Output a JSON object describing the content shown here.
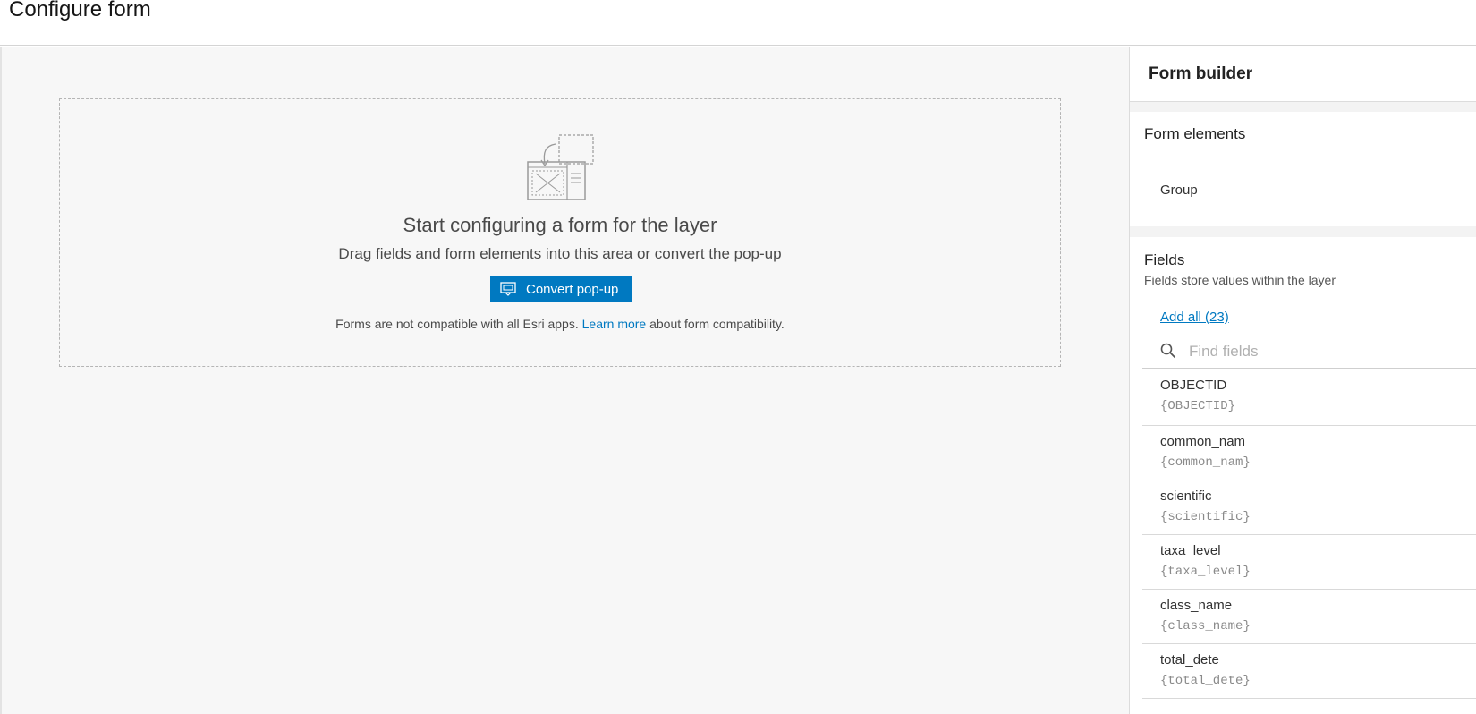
{
  "header": {
    "title": "Configure form"
  },
  "canvas": {
    "heading": "Start configuring a form for the layer",
    "subtext": "Drag fields and form elements into this area or convert the pop-up",
    "convert_button_label": "Convert pop-up",
    "note_prefix": "Forms are not compatible with all Esri apps.",
    "note_link": "Learn more",
    "note_suffix": "about form compatibility."
  },
  "panel": {
    "title": "Form builder",
    "form_elements": {
      "title": "Form elements",
      "items": [
        "Group"
      ]
    },
    "fields": {
      "title": "Fields",
      "description": "Fields store values within the layer",
      "add_all_label": "Add all (23)",
      "search_placeholder": "Find fields",
      "items": [
        {
          "name": "OBJECTID",
          "token": "{OBJECTID}"
        },
        {
          "name": "common_nam",
          "token": "{common_nam}"
        },
        {
          "name": "scientific",
          "token": "{scientific}"
        },
        {
          "name": "taxa_level",
          "token": "{taxa_level}"
        },
        {
          "name": "class_name",
          "token": "{class_name}"
        },
        {
          "name": "total_dete",
          "token": "{total_dete}"
        }
      ]
    }
  },
  "colors": {
    "accent": "#0079c1",
    "canvas_bg": "#f7f7f7",
    "panel_bg": "#f3f3f3"
  },
  "icons": {
    "illustration": "form-drag-illustration",
    "convert": "popup-convert-icon",
    "search": "search-icon"
  }
}
